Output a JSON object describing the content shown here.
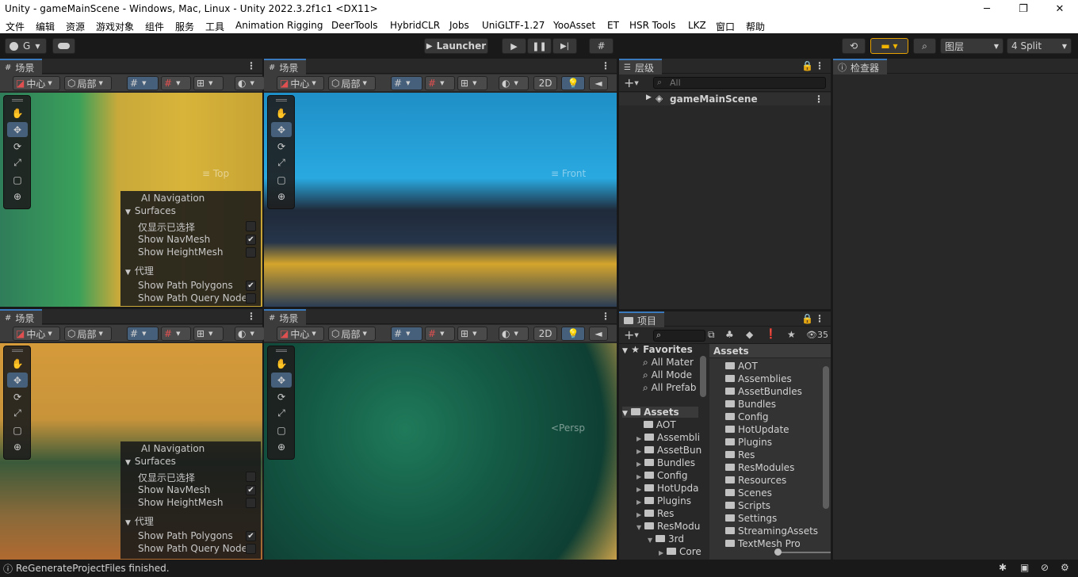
{
  "window": {
    "title": "Unity - gameMainScene - Windows, Mac, Linux - Unity 2022.3.2f1c1 <DX11>",
    "minimize": "─",
    "maximize": "❐",
    "close": "✕"
  },
  "menu": [
    "文件",
    "编辑",
    "资源",
    "游戏对象",
    "组件",
    "服务",
    "工具",
    "Animation Rigging",
    "DeerTools",
    "HybridCLR",
    "Jobs",
    "UniGLTF-1.27",
    "YooAsset",
    "ET",
    "HSR Tools",
    "LKZ",
    "窗口",
    "帮助"
  ],
  "toolbar": {
    "account": "G",
    "launcher": "Launcher",
    "layers": "图层",
    "layout": "4 Split"
  },
  "scene": {
    "tab": "场景",
    "pivot": "中心",
    "local": "局部",
    "mode2d": "2D",
    "views": [
      {
        "gizmo": "≡ Top"
      },
      {
        "gizmo": "≡ Front"
      },
      {
        "gizmo": ""
      },
      {
        "gizmo": "<Persp"
      }
    ],
    "overlay": {
      "title": "AI Navigation",
      "surfaces": "Surfaces",
      "only_selected": "仅显示已选择",
      "show_navmesh": "Show NavMesh",
      "show_heightmesh": "Show HeightMesh",
      "agents": "代理",
      "path_polygons": "Show Path Polygons",
      "path_query": "Show Path Query Nodes"
    }
  },
  "hierarchy": {
    "tab": "层级",
    "search_placeholder": "All",
    "scene_name": "gameMainScene"
  },
  "inspector": {
    "tab": "检查器"
  },
  "project": {
    "tab": "项目",
    "badge": "35",
    "favorites": "Favorites",
    "fav_items": [
      "All Mater",
      "All Mode",
      "All Prefab"
    ],
    "assets_root": "Assets",
    "tree_items": [
      "AOT",
      "Assembli",
      "AssetBun",
      "Bundles",
      "Config",
      "HotUpda",
      "Plugins",
      "Res",
      "ResModu",
      "3rd",
      "Core"
    ],
    "assets_header": "Assets",
    "asset_list": [
      "AOT",
      "Assemblies",
      "AssetBundles",
      "Bundles",
      "Config",
      "HotUpdate",
      "Plugins",
      "Res",
      "ResModules",
      "Resources",
      "Scenes",
      "Scripts",
      "Settings",
      "StreamingAssets",
      "TextMesh Pro"
    ]
  },
  "status": {
    "message": "ReGenerateProjectFiles finished."
  },
  "colors": {
    "accent": "#3a79bb",
    "active_btn": "#46607c",
    "panel": "#282828",
    "toolbar_bg": "#191919"
  }
}
